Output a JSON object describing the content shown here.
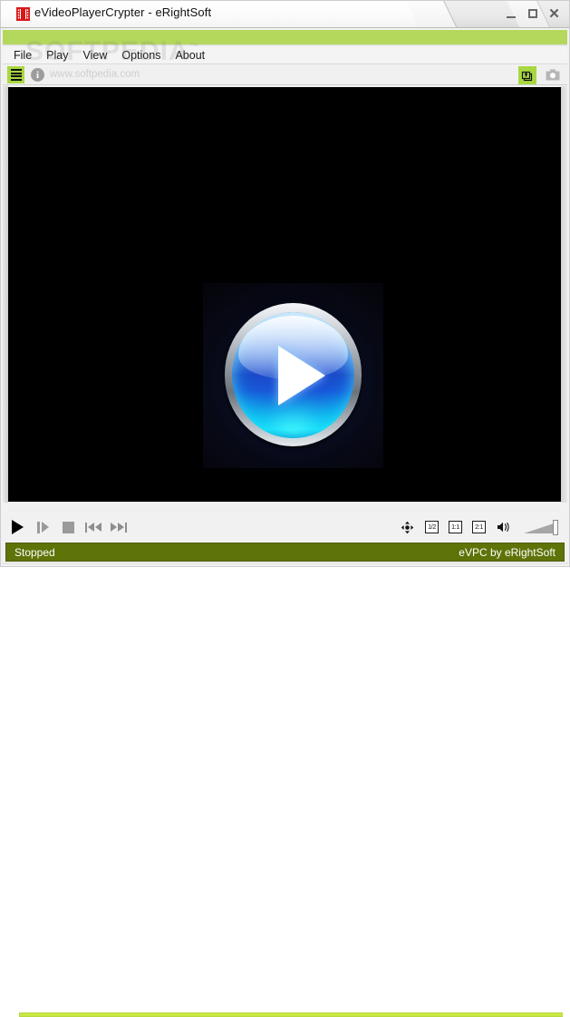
{
  "window": {
    "title": "eVideoPlayerCrypter - eRightSoft",
    "app_icon": "film-strip-icon",
    "controls": {
      "minimize_label": "Minimize",
      "maximize_label": "Maximize",
      "close_label": "Close"
    }
  },
  "menubar": {
    "items": [
      {
        "label": "File"
      },
      {
        "label": "Play"
      },
      {
        "label": "View"
      },
      {
        "label": "Options"
      },
      {
        "label": "About"
      }
    ]
  },
  "watermark": {
    "text": "SOFTPEDIA",
    "trademark": "™"
  },
  "toolbar": {
    "playlist_icon": "playlist-lines-icon",
    "info_icon": "info-circle-icon",
    "info_label": "i",
    "url_text": "www.softpedia.com",
    "add_playlist_icon": "add-to-playlist-icon",
    "snapshot_icon": "camera-snapshot-icon"
  },
  "video": {
    "logo": "play-button-logo",
    "background_color": "#000000"
  },
  "seek": {
    "progress_percent": 100,
    "track_color": "#c8e845"
  },
  "controls": {
    "play_label": "Play",
    "pause_label": "Pause",
    "stop_label": "Stop",
    "previous_label": "Previous",
    "next_label": "Next",
    "pan_label": "Pan",
    "zoom_half_label": "1/2",
    "zoom_one_label": "1:1",
    "zoom_two_label": "2:1",
    "mute_label": "Mute",
    "volume_percent": 100
  },
  "statusbar": {
    "status": "Stopped",
    "credit": "eVPC by eRightSoft",
    "background_color": "#5e7308"
  },
  "colors": {
    "accent_green": "#b4d85c",
    "toolbar_green": "#a8d840",
    "seek_green": "#c8e845",
    "status_olive": "#5e7308"
  }
}
